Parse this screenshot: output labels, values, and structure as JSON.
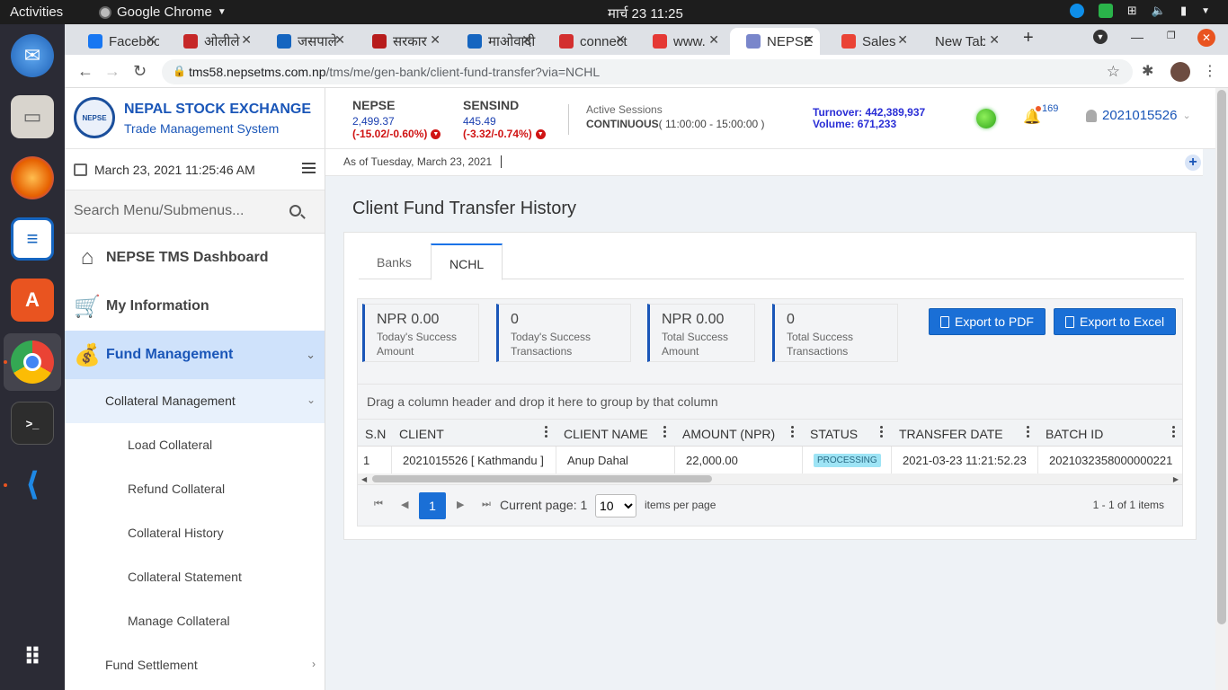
{
  "os": {
    "activities": "Activities",
    "app_name": "Google Chrome",
    "clock": "मार्च 23  11:25"
  },
  "browser": {
    "tabs": [
      {
        "label": "Facebook",
        "fav_color": "#1877f2"
      },
      {
        "label": "ओलीले",
        "fav_color": "#c62828"
      },
      {
        "label": "जसपाले",
        "fav_color": "#1565c0"
      },
      {
        "label": "सरकार",
        "fav_color": "#b71c1c"
      },
      {
        "label": "माओवादी",
        "fav_color": "#1565c0"
      },
      {
        "label": "connect",
        "fav_color": "#d32f2f"
      },
      {
        "label": "www.",
        "fav_color": "#e53935"
      },
      {
        "label": "NEPSE",
        "fav_color": "#7986cb"
      },
      {
        "label": "Sales",
        "fav_color": "#ea4335"
      },
      {
        "label": "New Tab",
        "fav_color": ""
      }
    ],
    "url_host": "tms58.nepsetms.com.np",
    "url_path": "/tms/me/gen-bank/client-fund-transfer?via=NCHL"
  },
  "header": {
    "brand_title": "NEPAL STOCK EXCHANGE",
    "brand_subtitle": "Trade Management System",
    "logo_text": "NEPAL STOCK EXCHANGE 1993",
    "nepse": {
      "name": "NEPSE",
      "value": "2,499.37",
      "change": "(-15.02/-0.60%)"
    },
    "sensind": {
      "name": "SENSIND",
      "value": "445.49",
      "change": "(-3.32/-0.74%)"
    },
    "sessions_label": "Active Sessions",
    "sessions_status": "CONTINUOUS",
    "sessions_time": "( 11:00:00 - 15:00:00 )",
    "turnover": "Turnover: 442,389,937",
    "volume": "Volume: 671,233",
    "notification_count": "169",
    "username": "2021015526"
  },
  "sidebar": {
    "datetime": "March 23, 2021 11:25:46 AM",
    "search_placeholder": "Search Menu/Submenus...",
    "items": [
      {
        "label": "NEPSE TMS Dashboard"
      },
      {
        "label": "My Information"
      },
      {
        "label": "Fund Management"
      }
    ],
    "sub_items": [
      {
        "label": "Collateral Management"
      },
      {
        "label": "Fund Settlement"
      }
    ],
    "leaf_items": [
      {
        "label": "Load Collateral"
      },
      {
        "label": "Refund Collateral"
      },
      {
        "label": "Collateral History"
      },
      {
        "label": "Collateral Statement"
      },
      {
        "label": "Manage Collateral"
      }
    ]
  },
  "main": {
    "as_of": "As of Tuesday, March 23, 2021",
    "page_title": "Client Fund Transfer History",
    "tabs": [
      {
        "label": "Banks"
      },
      {
        "label": "NCHL"
      }
    ],
    "stats": [
      {
        "value": "NPR 0.00",
        "label_line1": "Today's Success",
        "label_line2": "Amount"
      },
      {
        "value": "0",
        "label_line1": "Today's Success",
        "label_line2": "Transactions"
      },
      {
        "value": "NPR 0.00",
        "label_line1": "Total Success",
        "label_line2": "Amount"
      },
      {
        "value": "0",
        "label_line1": "Total Success",
        "label_line2": "Transactions"
      }
    ],
    "export_pdf": "Export to PDF",
    "export_excel": "Export to Excel",
    "group_hint": "Drag a column header and drop it here to group by that column",
    "columns": [
      "S.N",
      "CLIENT",
      "CLIENT NAME",
      "AMOUNT (NPR)",
      "STATUS",
      "TRANSFER DATE",
      "BATCH ID"
    ],
    "rows": [
      {
        "sn": "1",
        "client": "2021015526 [ Kathmandu ]",
        "client_name": "Anup Dahal",
        "amount": "22,000.00",
        "status": "PROCESSING",
        "transfer_date": "2021-03-23 11:21:52.23",
        "batch_id": "2021032358000000221"
      }
    ],
    "pager": {
      "current_page_number": "1",
      "current_page_text": "Current page: 1",
      "page_size": "10",
      "items_per_page": "items per page",
      "count_text": "1 - 1 of 1 items"
    }
  }
}
